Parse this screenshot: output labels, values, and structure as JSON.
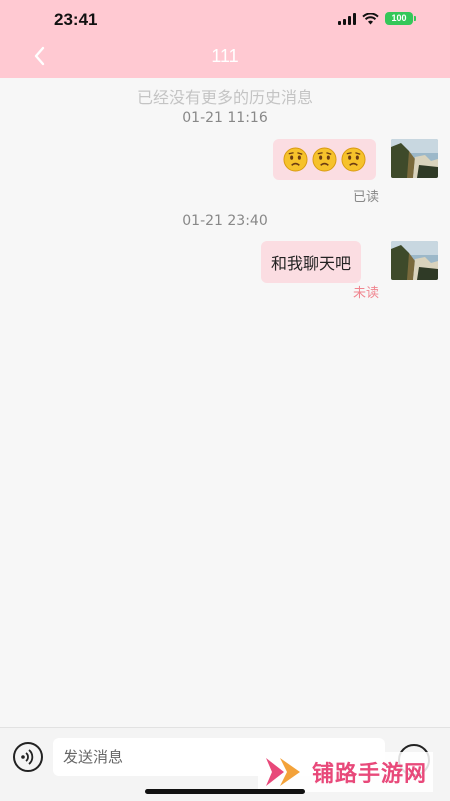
{
  "status_bar": {
    "time": "23:41",
    "battery": "100"
  },
  "header": {
    "title": "111"
  },
  "chat": {
    "no_more_history": "已经没有更多的历史消息",
    "messages": [
      {
        "timestamp": "01-21 11:16",
        "type": "emoji",
        "emoji_count": 3,
        "emoji_icon": "confused-face-icon",
        "status": "已读",
        "status_color": "#888888"
      },
      {
        "timestamp": "01-21 23:40",
        "type": "text",
        "text": "和我聊天吧",
        "status": "未读",
        "status_color": "#f0858f"
      }
    ]
  },
  "composer": {
    "placeholder": "发送消息"
  },
  "watermark": {
    "text": "铺路手游网"
  },
  "colors": {
    "header_bg": "#ffc9d2",
    "bubble_bg": "#fbdde2",
    "unread": "#f0858f",
    "battery": "#34c759"
  }
}
